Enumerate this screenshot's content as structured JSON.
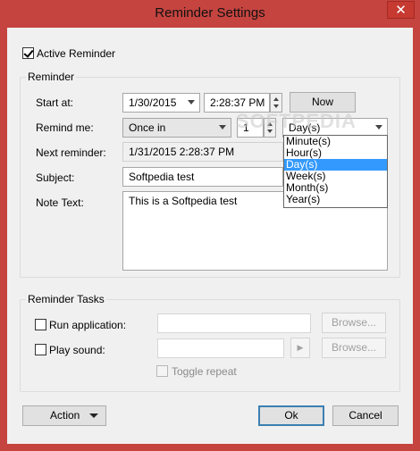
{
  "window": {
    "title": "Reminder Settings",
    "close_glyph": "✕"
  },
  "active_reminder": {
    "label": "Active Reminder",
    "checked": true
  },
  "reminder_group": {
    "title": "Reminder",
    "start_at": {
      "label": "Start at:",
      "date": "1/30/2015",
      "time": "2:28:37 PM",
      "now_label": "Now"
    },
    "remind_me": {
      "label": "Remind me:",
      "mode": "Once in",
      "count": "1",
      "unit": "Day(s)",
      "unit_options": [
        "Minute(s)",
        "Hour(s)",
        "Day(s)",
        "Week(s)",
        "Month(s)",
        "Year(s)"
      ],
      "selected_index": 2
    },
    "next_reminder": {
      "label": "Next reminder:",
      "value": "1/31/2015 2:28:37 PM"
    },
    "subject": {
      "label": "Subject:",
      "value": "Softpedia test"
    },
    "note_text": {
      "label": "Note Text:",
      "value": "This is a Softpedia test"
    }
  },
  "tasks_group": {
    "title": "Reminder Tasks",
    "run_application": {
      "label": "Run application:",
      "checked": false,
      "value": "",
      "browse_label": "Browse..."
    },
    "play_sound": {
      "label": "Play sound:",
      "checked": false,
      "value": "",
      "play_glyph": "▶",
      "browse_label": "Browse..."
    },
    "toggle_repeat": {
      "label": "Toggle repeat",
      "checked": false
    }
  },
  "footer": {
    "action_label": "Action",
    "ok_label": "Ok",
    "cancel_label": "Cancel"
  },
  "watermark": "SOFTPEDIA",
  "colors": {
    "window_frame": "#c5443f",
    "client_bg": "#f0f0f0",
    "selection": "#3399ff",
    "close_button": "#c63a32"
  }
}
